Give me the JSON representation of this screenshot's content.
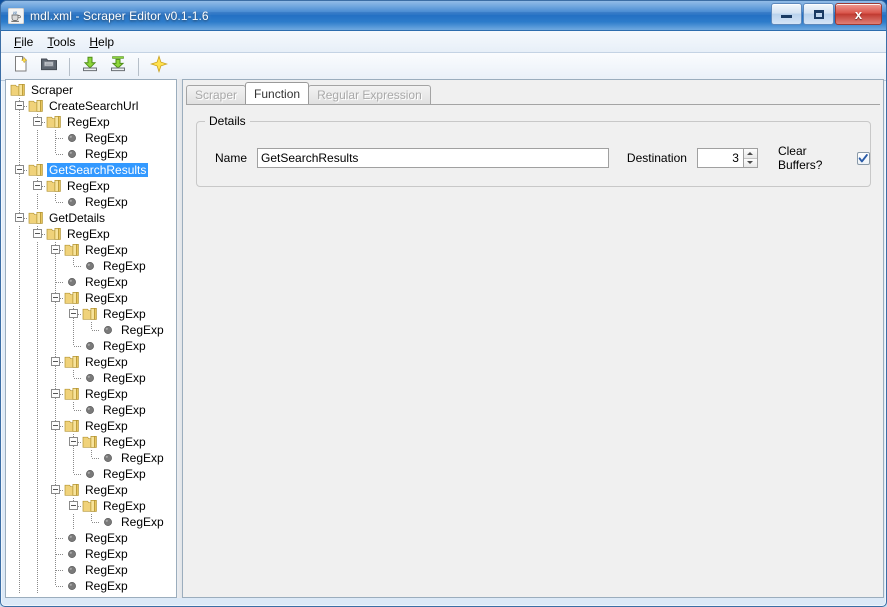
{
  "window": {
    "title": "mdl.xml - Scraper Editor v0.1-1.6",
    "app_icon": "java-coffee-cup-icon",
    "buttons": {
      "minimize": "minimize-icon",
      "maximize": "restore-icon",
      "close": "x"
    }
  },
  "menubar": {
    "items": [
      {
        "label": "File",
        "mnemonic": "F"
      },
      {
        "label": "Tools",
        "mnemonic": "T"
      },
      {
        "label": "Help",
        "mnemonic": "H"
      }
    ]
  },
  "toolbar": {
    "items": [
      {
        "name": "new-file-icon",
        "type": "button"
      },
      {
        "name": "open-folder-icon",
        "type": "button"
      },
      {
        "name": "separator",
        "type": "separator"
      },
      {
        "name": "import-icon",
        "type": "button"
      },
      {
        "name": "export-icon",
        "type": "button"
      },
      {
        "name": "separator",
        "type": "separator"
      },
      {
        "name": "magic-wand-icon",
        "type": "button"
      }
    ]
  },
  "tree": {
    "nodes": [
      {
        "label": "Scraper",
        "depth": 0,
        "kind": "folder",
        "expanded": null,
        "selected": false
      },
      {
        "label": "CreateSearchUrl",
        "depth": 1,
        "kind": "folder",
        "expanded": true,
        "selected": false
      },
      {
        "label": "RegExp",
        "depth": 2,
        "kind": "folder",
        "expanded": true,
        "selected": false
      },
      {
        "label": "RegExp",
        "depth": 3,
        "kind": "leaf",
        "expanded": null,
        "selected": false
      },
      {
        "label": "RegExp",
        "depth": 3,
        "kind": "leaf",
        "expanded": null,
        "selected": false
      },
      {
        "label": "GetSearchResults",
        "depth": 1,
        "kind": "folder",
        "expanded": true,
        "selected": true
      },
      {
        "label": "RegExp",
        "depth": 2,
        "kind": "folder",
        "expanded": true,
        "selected": false
      },
      {
        "label": "RegExp",
        "depth": 3,
        "kind": "leaf",
        "expanded": null,
        "selected": false
      },
      {
        "label": "GetDetails",
        "depth": 1,
        "kind": "folder",
        "expanded": true,
        "selected": false
      },
      {
        "label": "RegExp",
        "depth": 2,
        "kind": "folder",
        "expanded": true,
        "selected": false
      },
      {
        "label": "RegExp",
        "depth": 3,
        "kind": "folder",
        "expanded": true,
        "selected": false
      },
      {
        "label": "RegExp",
        "depth": 4,
        "kind": "leaf",
        "expanded": null,
        "selected": false
      },
      {
        "label": "RegExp",
        "depth": 3,
        "kind": "leaf",
        "expanded": null,
        "selected": false
      },
      {
        "label": "RegExp",
        "depth": 3,
        "kind": "folder",
        "expanded": true,
        "selected": false
      },
      {
        "label": "RegExp",
        "depth": 4,
        "kind": "folder",
        "expanded": true,
        "selected": false
      },
      {
        "label": "RegExp",
        "depth": 5,
        "kind": "leaf",
        "expanded": null,
        "selected": false
      },
      {
        "label": "RegExp",
        "depth": 4,
        "kind": "leaf",
        "expanded": null,
        "selected": false
      },
      {
        "label": "RegExp",
        "depth": 3,
        "kind": "folder",
        "expanded": true,
        "selected": false
      },
      {
        "label": "RegExp",
        "depth": 4,
        "kind": "leaf",
        "expanded": null,
        "selected": false
      },
      {
        "label": "RegExp",
        "depth": 3,
        "kind": "folder",
        "expanded": true,
        "selected": false
      },
      {
        "label": "RegExp",
        "depth": 4,
        "kind": "leaf",
        "expanded": null,
        "selected": false
      },
      {
        "label": "RegExp",
        "depth": 3,
        "kind": "folder",
        "expanded": true,
        "selected": false
      },
      {
        "label": "RegExp",
        "depth": 4,
        "kind": "folder",
        "expanded": true,
        "selected": false
      },
      {
        "label": "RegExp",
        "depth": 5,
        "kind": "leaf",
        "expanded": null,
        "selected": false
      },
      {
        "label": "RegExp",
        "depth": 4,
        "kind": "leaf",
        "expanded": null,
        "selected": false
      },
      {
        "label": "RegExp",
        "depth": 3,
        "kind": "folder",
        "expanded": true,
        "selected": false
      },
      {
        "label": "RegExp",
        "depth": 4,
        "kind": "folder",
        "expanded": true,
        "selected": false
      },
      {
        "label": "RegExp",
        "depth": 5,
        "kind": "leaf",
        "expanded": null,
        "selected": false
      },
      {
        "label": "RegExp",
        "depth": 3,
        "kind": "leaf",
        "expanded": null,
        "selected": false
      },
      {
        "label": "RegExp",
        "depth": 3,
        "kind": "leaf",
        "expanded": null,
        "selected": false
      },
      {
        "label": "RegExp",
        "depth": 3,
        "kind": "leaf",
        "expanded": null,
        "selected": false
      },
      {
        "label": "RegExp",
        "depth": 3,
        "kind": "leaf",
        "expanded": null,
        "selected": false
      }
    ]
  },
  "tabs": [
    {
      "label": "Scraper",
      "active": false,
      "enabled": false
    },
    {
      "label": "Function",
      "active": true,
      "enabled": true
    },
    {
      "label": "Regular Expression",
      "active": false,
      "enabled": false
    }
  ],
  "details": {
    "group_title": "Details",
    "name_label": "Name",
    "name_value": "GetSearchResults",
    "destination_label": "Destination",
    "destination_value": "3",
    "clear_buffers_label": "Clear Buffers?",
    "clear_buffers_checked": true
  },
  "colors": {
    "selection": "#3399ff",
    "title_bar": "#2f7ccd",
    "close_button": "#c03a30",
    "folder_icon": "#e8c15a",
    "leaf_icon": "#777777",
    "disabled_tab_text": "#a9a9a9"
  }
}
